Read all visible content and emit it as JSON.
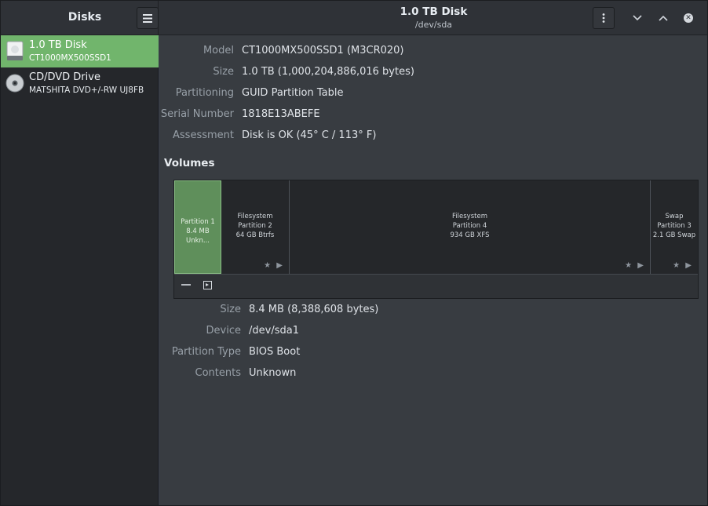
{
  "header": {
    "app_title": "Disks",
    "disk_title": "1.0 TB Disk",
    "disk_device": "/dev/sda"
  },
  "sidebar": {
    "drives": [
      {
        "name": "1.0 TB Disk",
        "sub": "CT1000MX500SSD1",
        "icon": "ssd-icon",
        "selected": true
      },
      {
        "name": "CD/DVD Drive",
        "sub": "MATSHITA DVD+/-RW UJ8FB",
        "icon": "optical-disc-icon",
        "selected": false
      }
    ]
  },
  "disk_info": [
    {
      "key": "Model",
      "value": "CT1000MX500SSD1 (M3CR020)"
    },
    {
      "key": "Size",
      "value": "1.0 TB (1,000,204,886,016 bytes)"
    },
    {
      "key": "Partitioning",
      "value": "GUID Partition Table"
    },
    {
      "key": "Serial Number",
      "value": "1818E13ABEFE"
    },
    {
      "key": "Assessment",
      "value": "Disk is OK (45° C / 113° F)"
    }
  ],
  "volumes": {
    "title": "Volumes",
    "partitions": [
      {
        "line1": "Partition 1",
        "line2": "8.4 MB Unkn...",
        "line3": ""
      },
      {
        "line1": "Filesystem",
        "line2": "Partition 2",
        "line3": "64 GB Btrfs"
      },
      {
        "line1": "Filesystem",
        "line2": "Partition 4",
        "line3": "934 GB XFS"
      },
      {
        "line1": "Swap",
        "line2": "Partition 3",
        "line3": "2.1 GB Swap"
      }
    ],
    "star_glyph": "★ ▶"
  },
  "partition_info": [
    {
      "key": "Size",
      "value": "8.4 MB (8,388,608 bytes)"
    },
    {
      "key": "Device",
      "value": "/dev/sda1"
    },
    {
      "key": "Partition Type",
      "value": "BIOS Boot"
    },
    {
      "key": "Contents",
      "value": "Unknown"
    }
  ],
  "colors": {
    "selected_drive": "#71b56c",
    "selected_partition": "#5f8f5b"
  }
}
